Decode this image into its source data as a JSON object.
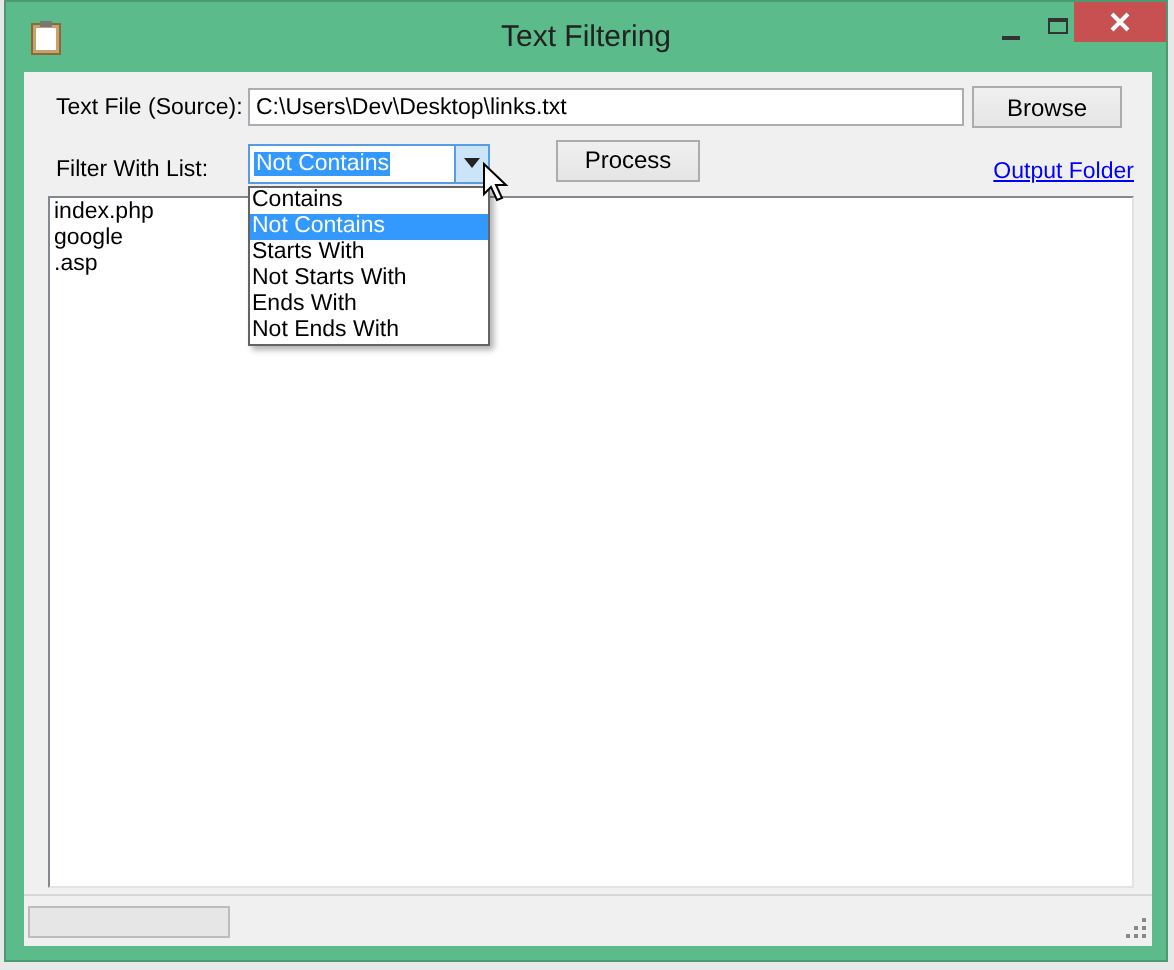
{
  "window": {
    "title": "Text Filtering"
  },
  "source": {
    "label": "Text File (Source):",
    "value": "C:\\Users\\Dev\\Desktop\\links.txt"
  },
  "browse_button": "Browse",
  "filter": {
    "label": "Filter With List:",
    "value": "Not Contains",
    "expanded": true,
    "options": [
      {
        "label": "Contains",
        "selected": false
      },
      {
        "label": "Not Contains",
        "selected": true
      },
      {
        "label": "Starts With",
        "selected": false
      },
      {
        "label": "Not Starts With",
        "selected": false
      },
      {
        "label": "Ends With",
        "selected": false
      },
      {
        "label": "Not Ends With",
        "selected": false
      }
    ]
  },
  "process_button": "Process",
  "output_link": "Output Folder",
  "list_lines": [
    "index.php",
    "google",
    ".asp"
  ]
}
